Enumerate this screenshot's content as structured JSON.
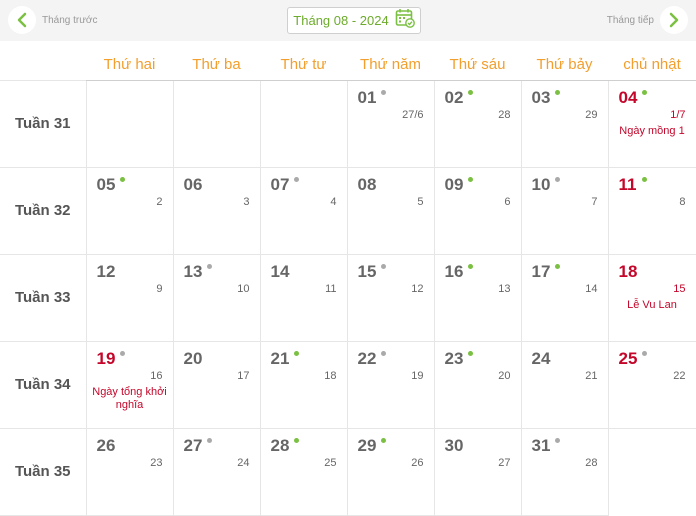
{
  "nav": {
    "prev_label": "Tháng trước",
    "next_label": "Tháng tiếp",
    "month_label": "Tháng 08 - 2024"
  },
  "colors": {
    "accent_orange": "#f29f2d",
    "accent_green": "#6cab2b",
    "holiday_red": "#c4062a"
  },
  "weekdays": [
    "Thứ hai",
    "Thứ ba",
    "Thứ tư",
    "Thứ năm",
    "Thứ sáu",
    "Thứ bảy",
    "chủ nhật"
  ],
  "weeks": [
    {
      "label": "Tuần 31",
      "days": [
        null,
        null,
        null,
        {
          "solar": "01",
          "lunar": "27/6",
          "dot": "gray"
        },
        {
          "solar": "02",
          "lunar": "28",
          "dot": "green"
        },
        {
          "solar": "03",
          "lunar": "29",
          "dot": "green"
        },
        {
          "solar": "04",
          "lunar": "1/7",
          "dot": "green",
          "red": true,
          "event": "Ngày mồng 1"
        }
      ]
    },
    {
      "label": "Tuần 32",
      "days": [
        {
          "solar": "05",
          "lunar": "2",
          "dot": "green"
        },
        {
          "solar": "06",
          "lunar": "3"
        },
        {
          "solar": "07",
          "lunar": "4",
          "dot": "gray"
        },
        {
          "solar": "08",
          "lunar": "5"
        },
        {
          "solar": "09",
          "lunar": "6",
          "dot": "green"
        },
        {
          "solar": "10",
          "lunar": "7",
          "dot": "gray"
        },
        {
          "solar": "11",
          "lunar": "8",
          "dot": "green",
          "red": true
        }
      ]
    },
    {
      "label": "Tuần 33",
      "days": [
        {
          "solar": "12",
          "lunar": "9"
        },
        {
          "solar": "13",
          "lunar": "10",
          "dot": "gray"
        },
        {
          "solar": "14",
          "lunar": "11"
        },
        {
          "solar": "15",
          "lunar": "12",
          "dot": "gray"
        },
        {
          "solar": "16",
          "lunar": "13",
          "dot": "green"
        },
        {
          "solar": "17",
          "lunar": "14",
          "dot": "green"
        },
        {
          "solar": "18",
          "lunar": "15",
          "red": true,
          "lunar_red": true,
          "event": "Lễ Vu Lan"
        }
      ]
    },
    {
      "label": "Tuần 34",
      "days": [
        {
          "solar": "19",
          "lunar": "16",
          "dot": "gray",
          "red": true,
          "event": "Ngày tổng khởi nghĩa"
        },
        {
          "solar": "20",
          "lunar": "17"
        },
        {
          "solar": "21",
          "lunar": "18",
          "dot": "green"
        },
        {
          "solar": "22",
          "lunar": "19",
          "dot": "gray"
        },
        {
          "solar": "23",
          "lunar": "20",
          "dot": "green"
        },
        {
          "solar": "24",
          "lunar": "21"
        },
        {
          "solar": "25",
          "lunar": "22",
          "dot": "gray",
          "red": true
        }
      ]
    },
    {
      "label": "Tuần 35",
      "days": [
        {
          "solar": "26",
          "lunar": "23"
        },
        {
          "solar": "27",
          "lunar": "24",
          "dot": "gray"
        },
        {
          "solar": "28",
          "lunar": "25",
          "dot": "green"
        },
        {
          "solar": "29",
          "lunar": "26",
          "dot": "green"
        },
        {
          "solar": "30",
          "lunar": "27"
        },
        {
          "solar": "31",
          "lunar": "28",
          "dot": "gray"
        },
        "end"
      ]
    }
  ]
}
